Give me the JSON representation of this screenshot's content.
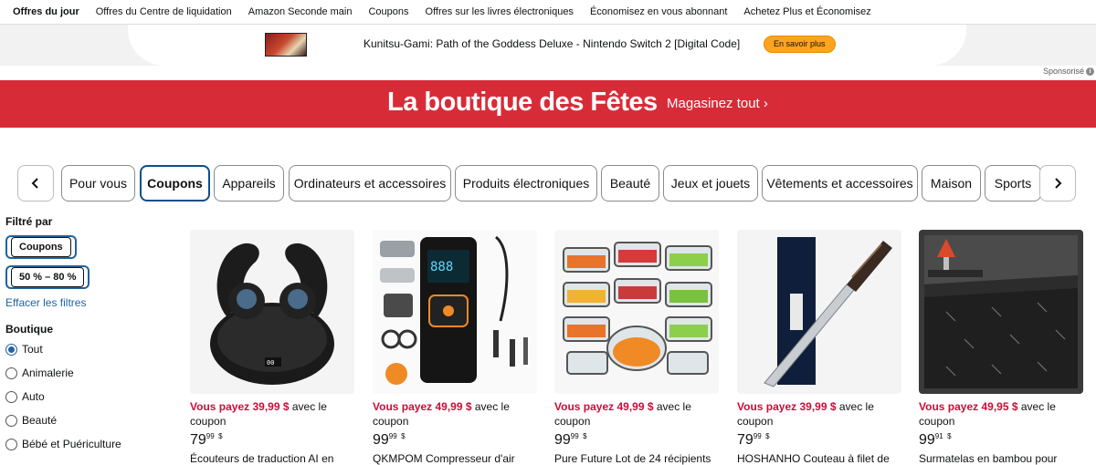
{
  "nav": {
    "items": [
      "Offres du jour",
      "Offres du Centre de liquidation",
      "Amazon Seconde main",
      "Coupons",
      "Offres sur les livres électroniques",
      "Économisez en vous abonnant",
      "Achetez Plus et Économisez"
    ]
  },
  "ad": {
    "title": "Kunitsu-Gami: Path of the Goddess Deluxe - Nintendo Switch 2 [Digital Code]",
    "button": "En savoir plus",
    "sponsored": "Sponsorisé"
  },
  "hero": {
    "title": "La boutique des Fêtes",
    "link": "Magasinez tout ›"
  },
  "categories": [
    "Pour vous",
    "Coupons",
    "Appareils",
    "Ordinateurs et accessoires",
    "Produits électroniques",
    "Beauté",
    "Jeux et jouets",
    "Vêtements et accessoires",
    "Maison",
    "Sports"
  ],
  "sidebar": {
    "filter_heading": "Filtré par",
    "chips": [
      "Coupons",
      "50 % – 80 %"
    ],
    "clear": "Effacer les filtres",
    "store_heading": "Boutique",
    "stores": [
      "Tout",
      "Animalerie",
      "Auto",
      "Beauté",
      "Bébé et Puériculture"
    ]
  },
  "products": [
    {
      "pay": "Vous payez 39,99 $",
      "rest": "avec le coupon",
      "price_whole": "79",
      "price_frac": "99",
      "currency": "$",
      "title": "Écouteurs de traduction AI en"
    },
    {
      "pay": "Vous payez 49,99 $",
      "rest": "avec le coupon",
      "price_whole": "99",
      "price_frac": "99",
      "currency": "$",
      "title": "QKMPOM Compresseur d'air"
    },
    {
      "pay": "Vous payez 49,99 $",
      "rest": "avec le coupon",
      "price_whole": "99",
      "price_frac": "99",
      "currency": "$",
      "title": "Pure Future Lot de 24 récipients"
    },
    {
      "pay": "Vous payez 39,99 $",
      "rest": "avec le coupon",
      "price_whole": "79",
      "price_frac": "99",
      "currency": "$",
      "title": "HOSHANHO Couteau à filet de"
    },
    {
      "pay": "Vous payez 49,95 $",
      "rest": "avec le coupon",
      "price_whole": "99",
      "price_frac": "91",
      "currency": "$",
      "title": "Surmatelas en bambou pour"
    }
  ],
  "colors": {
    "accent_red": "#cc0c39",
    "hero_red": "#d82b38",
    "link_blue": "#2162a1",
    "ad_button": "#ffa41c"
  }
}
